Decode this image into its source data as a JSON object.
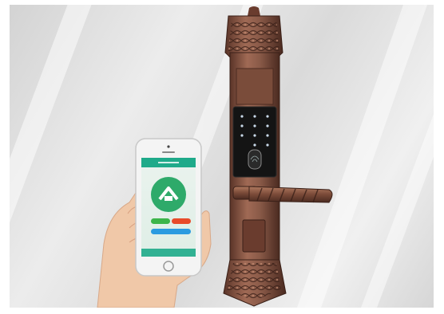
{
  "image": {
    "subject": "smart-lock-with-phone-app",
    "colors": {
      "frame": "#ffffff",
      "lock_bronze": "#8a5a48",
      "lock_dark": "#3e2620",
      "keypad_panel": "#141414",
      "keypad_light": "#c8d8e8",
      "app_header": "#1faa8a",
      "app_circle": "#2eaa6a",
      "app_btn_green": "#3cb54a",
      "app_btn_red": "#e84b2a",
      "app_btn_blue": "#2b9be0",
      "skin": "#f0c8a8"
    }
  }
}
